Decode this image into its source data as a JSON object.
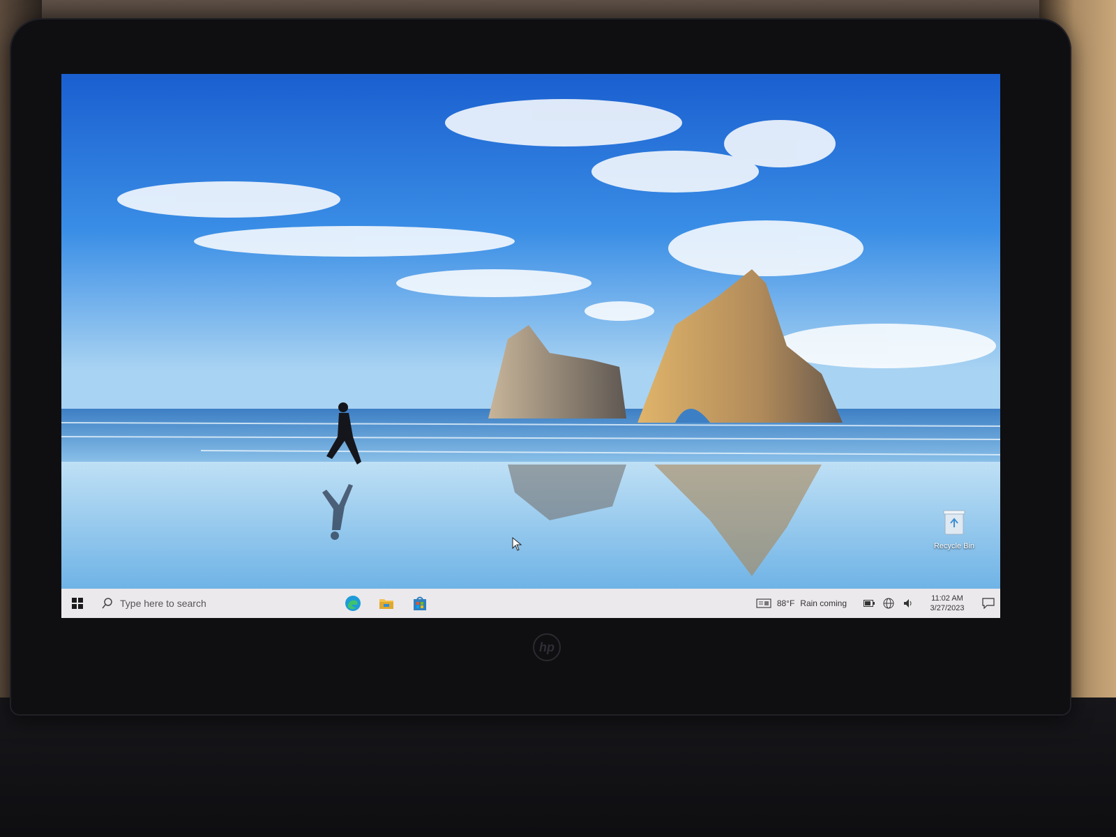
{
  "desktop": {
    "icons": [
      {
        "label": "Recycle Bin",
        "icon": "recycle-bin-icon"
      }
    ]
  },
  "taskbar": {
    "start_icon": "windows-logo-icon",
    "search_placeholder": "Type here to search",
    "pinned_apps": [
      {
        "name": "Microsoft Edge",
        "icon": "edge-icon"
      },
      {
        "name": "File Explorer",
        "icon": "folder-icon"
      },
      {
        "name": "Microsoft Store",
        "icon": "store-icon"
      }
    ],
    "weather": {
      "temperature": "88°F",
      "condition": "Rain coming"
    },
    "tray_icons": [
      "battery-icon",
      "network-globe-icon",
      "volume-icon"
    ],
    "clock": {
      "time": "11:02 AM",
      "date": "3/27/2023"
    },
    "notification_icon": "action-center-icon"
  },
  "colors": {
    "taskbar_bg": "#ece9ec",
    "edge_accent": "#1f9bd8",
    "store_accent": "#2f7fbf"
  }
}
